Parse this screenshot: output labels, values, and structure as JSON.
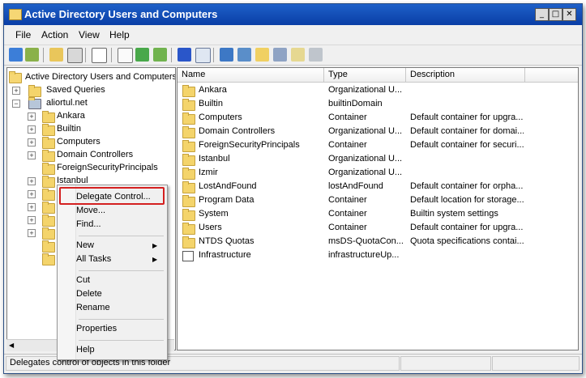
{
  "window": {
    "title": "Active Directory Users and Computers"
  },
  "window_buttons": {
    "minimize": "_",
    "maximize": "□",
    "close": "✕"
  },
  "menu": [
    "File",
    "Action",
    "View",
    "Help"
  ],
  "tree": {
    "root": "Active Directory Users and Computers",
    "saved_queries": "Saved Queries",
    "domain": "aliortul.net",
    "children": [
      "Ankara",
      "Builtin",
      "Computers",
      "Domain Controllers",
      "ForeignSecurityPrincipals",
      "Istanbul"
    ]
  },
  "list": {
    "columns": [
      "Name",
      "Type",
      "Description"
    ],
    "rows": [
      {
        "name": "Ankara",
        "type": "Organizational U...",
        "description": "",
        "icon": "folder-icon"
      },
      {
        "name": "Builtin",
        "type": "builtinDomain",
        "description": "",
        "icon": "folder-icon"
      },
      {
        "name": "Computers",
        "type": "Container",
        "description": "Default container for upgra...",
        "icon": "folder-icon"
      },
      {
        "name": "Domain Controllers",
        "type": "Organizational U...",
        "description": "Default container for domai...",
        "icon": "folder-icon"
      },
      {
        "name": "ForeignSecurityPrincipals",
        "type": "Container",
        "description": "Default container for securi...",
        "icon": "folder-icon"
      },
      {
        "name": "Istanbul",
        "type": "Organizational U...",
        "description": "",
        "icon": "folder-icon"
      },
      {
        "name": "Izmir",
        "type": "Organizational U...",
        "description": "",
        "icon": "folder-icon"
      },
      {
        "name": "LostAndFound",
        "type": "lostAndFound",
        "description": "Default container for orpha...",
        "icon": "folder-icon"
      },
      {
        "name": "Program Data",
        "type": "Container",
        "description": "Default location for storage...",
        "icon": "folder-icon"
      },
      {
        "name": "System",
        "type": "Container",
        "description": "Builtin system settings",
        "icon": "folder-icon"
      },
      {
        "name": "Users",
        "type": "Container",
        "description": "Default container for upgra...",
        "icon": "folder-icon"
      },
      {
        "name": "NTDS Quotas",
        "type": "msDS-QuotaCon...",
        "description": "Quota specifications contai...",
        "icon": "folder-icon"
      },
      {
        "name": "Infrastructure",
        "type": "infrastructureUp...",
        "description": "",
        "icon": "infrastructure-icon"
      }
    ]
  },
  "context_menu": {
    "items": [
      "Delegate Control...",
      "Move...",
      "Find...",
      "New",
      "All Tasks",
      "Cut",
      "Delete",
      "Rename",
      "Properties",
      "Help"
    ]
  },
  "status": {
    "text": "Delegates control of objects in this folder"
  },
  "colors": {
    "titlebar": "#0a3ea6",
    "highlight_box": "#d42020",
    "folder": "#f4d46b"
  }
}
